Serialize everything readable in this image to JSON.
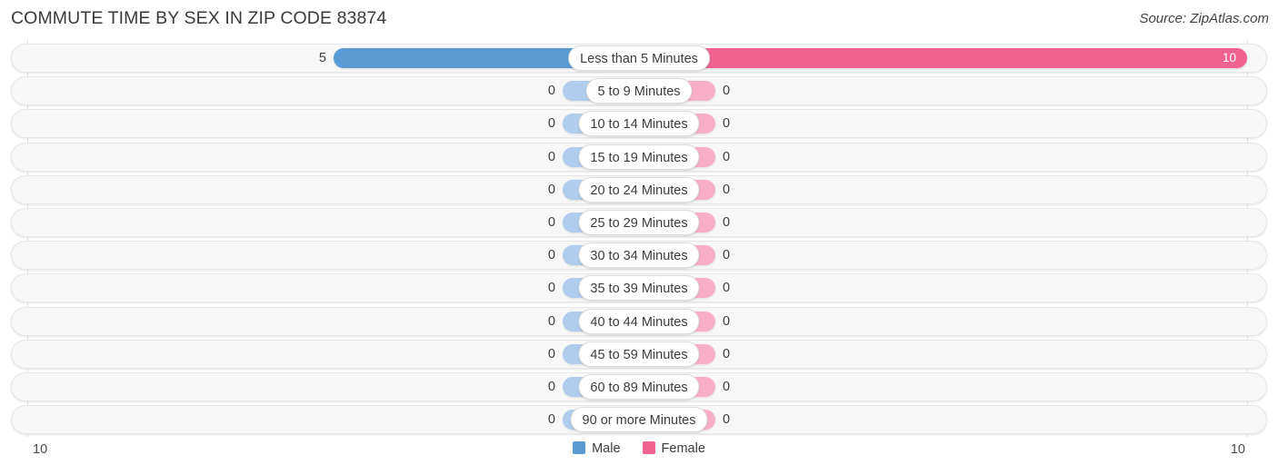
{
  "header": {
    "title": "COMMUTE TIME BY SEX IN ZIP CODE 83874",
    "source": "Source: ZipAtlas.com"
  },
  "legend": {
    "items": [
      {
        "label": "Male",
        "color": "#5b9bd5"
      },
      {
        "label": "Female",
        "color": "#f0628f"
      }
    ]
  },
  "axis": {
    "left_label": "10",
    "right_label": "10"
  },
  "chart_data": {
    "type": "bar",
    "subtype": "diverging-bidirectional",
    "title": "COMMUTE TIME BY SEX IN ZIP CODE 83874",
    "xlabel": "",
    "ylabel": "",
    "xlim": [
      10,
      10
    ],
    "grid": true,
    "legend_position": "bottom-center",
    "categories": [
      "Less than 5 Minutes",
      "5 to 9 Minutes",
      "10 to 14 Minutes",
      "15 to 19 Minutes",
      "20 to 24 Minutes",
      "25 to 29 Minutes",
      "30 to 34 Minutes",
      "35 to 39 Minutes",
      "40 to 44 Minutes",
      "45 to 59 Minutes",
      "60 to 89 Minutes",
      "90 or more Minutes"
    ],
    "series": [
      {
        "name": "Male",
        "color": "#5b9bd5",
        "direction": "left",
        "values": [
          5,
          0,
          0,
          0,
          0,
          0,
          0,
          0,
          0,
          0,
          0,
          0
        ],
        "labels": [
          "5",
          "0",
          "0",
          "0",
          "0",
          "0",
          "0",
          "0",
          "0",
          "0",
          "0",
          "0"
        ]
      },
      {
        "name": "Female",
        "color": "#f0628f",
        "direction": "right",
        "values": [
          10,
          0,
          0,
          0,
          0,
          0,
          0,
          0,
          0,
          0,
          0,
          0
        ],
        "labels": [
          "10",
          "0",
          "0",
          "0",
          "0",
          "0",
          "0",
          "0",
          "0",
          "0",
          "0",
          "0"
        ]
      }
    ]
  }
}
